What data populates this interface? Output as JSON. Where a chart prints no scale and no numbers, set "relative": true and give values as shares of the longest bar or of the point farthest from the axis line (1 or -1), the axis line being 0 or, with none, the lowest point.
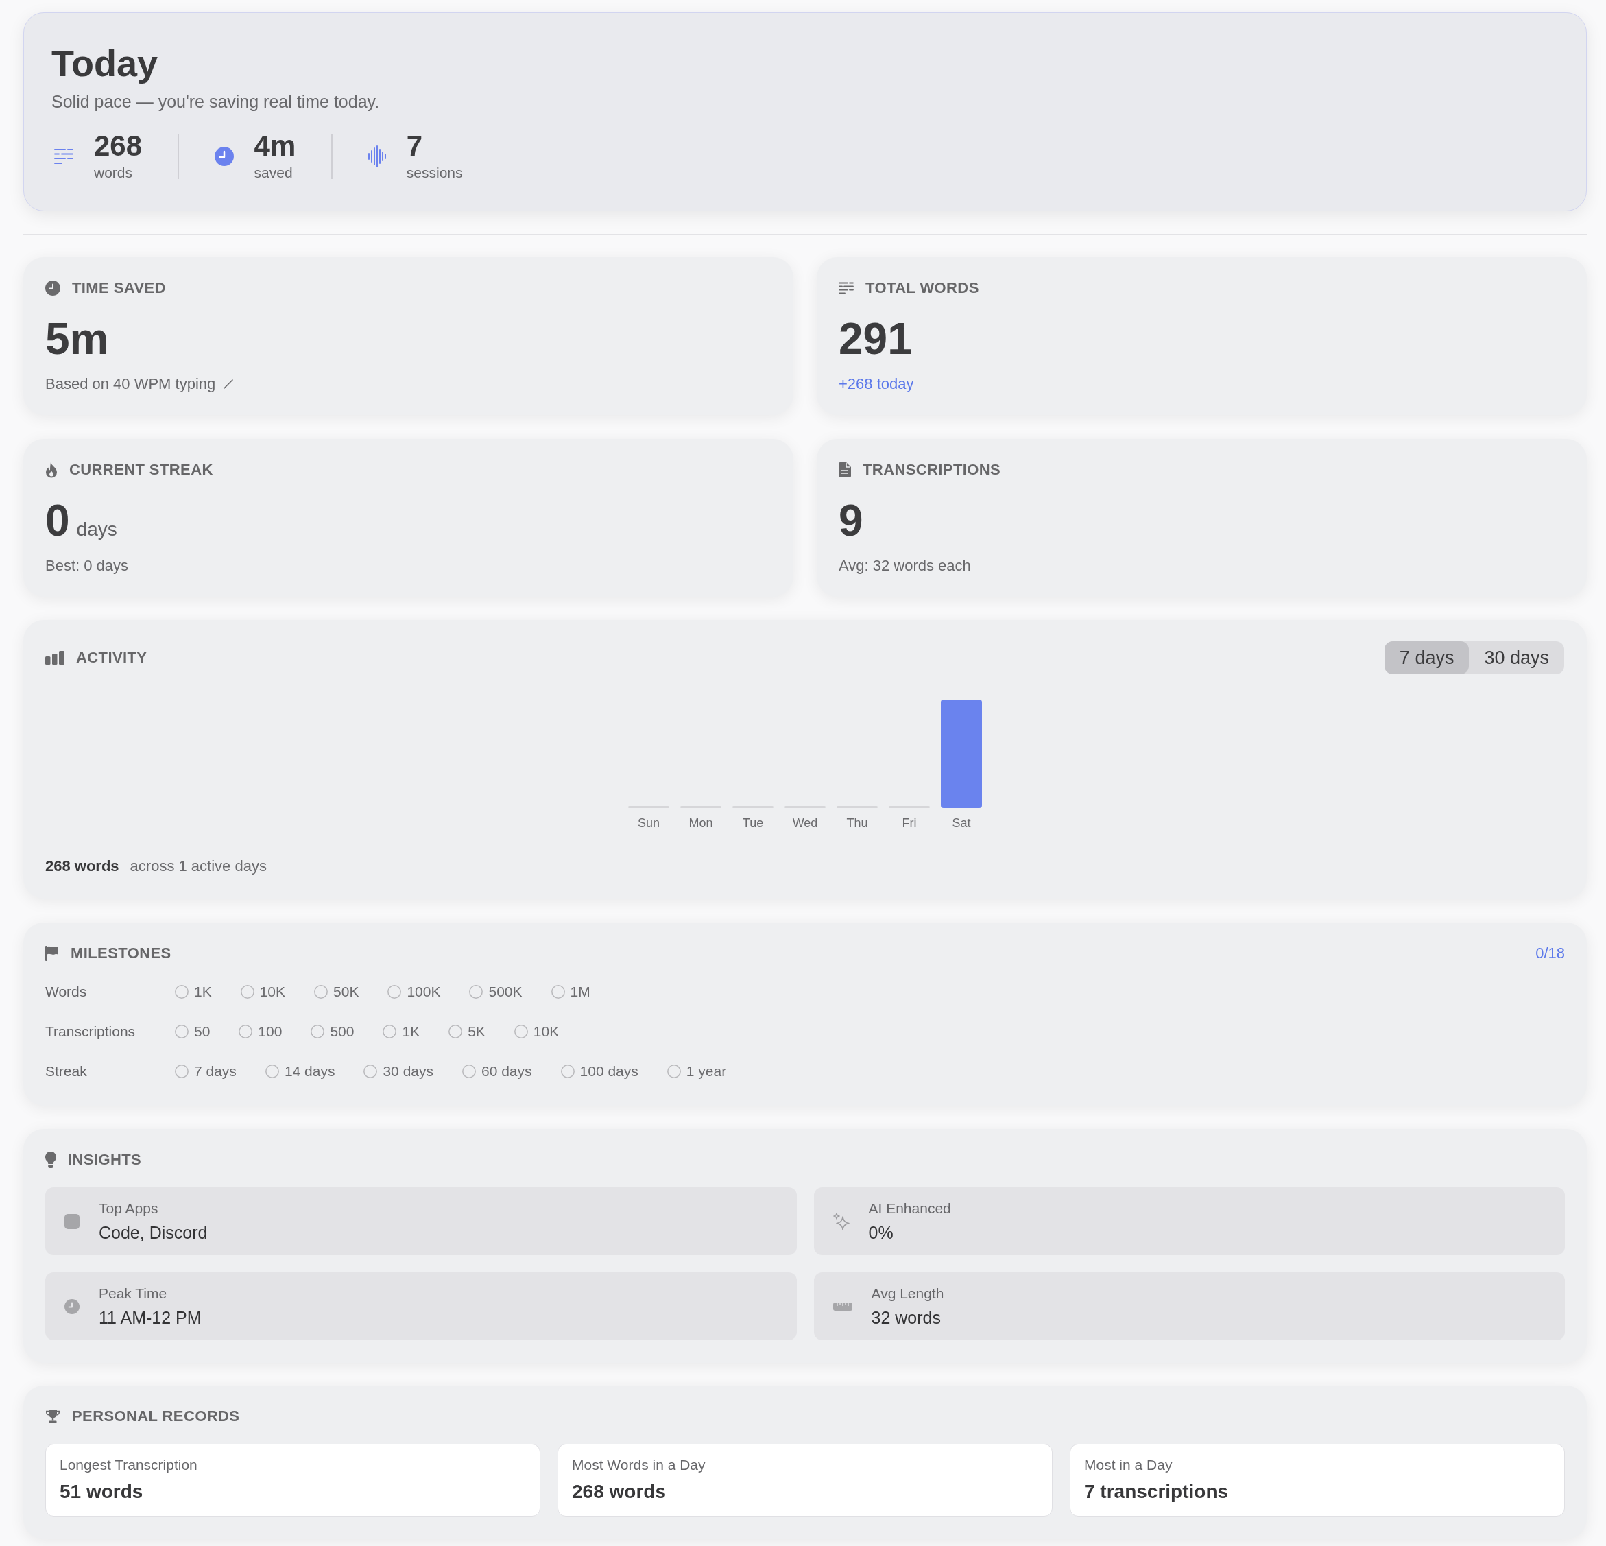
{
  "today": {
    "title": "Today",
    "subtitle": "Solid pace — you're saving real time today.",
    "stats": [
      {
        "kind": "words",
        "value": "268",
        "label": "words"
      },
      {
        "kind": "time",
        "value": "4m",
        "label": "saved"
      },
      {
        "kind": "sessions",
        "value": "7",
        "label": "sessions"
      }
    ]
  },
  "stat_cards": [
    {
      "kind": "time",
      "title": "TIME SAVED",
      "value": "5m",
      "note": "Based on 40 WPM typing",
      "editable": true
    },
    {
      "kind": "words",
      "title": "TOTAL WORDS",
      "value": "291",
      "trend": "+268 today",
      "editable": false
    },
    {
      "kind": "streak",
      "title": "CURRENT STREAK",
      "value": "0",
      "unit": "days",
      "note": "Best: 0 days",
      "editable": false
    },
    {
      "kind": "transcriptions",
      "title": "TRANSCRIPTIONS",
      "value": "9",
      "note": "Avg: 32 words each",
      "editable": false
    }
  ],
  "activity": {
    "title": "ACTIVITY",
    "ranges": [
      {
        "label": "7 days",
        "selected": true
      },
      {
        "label": "30 days",
        "selected": false
      }
    ],
    "chart_data": {
      "type": "bar",
      "relative": true,
      "categories": [
        "Sun",
        "Mon",
        "Tue",
        "Wed",
        "Thu",
        "Fri",
        "Sat"
      ],
      "values": [
        0,
        0,
        0,
        0,
        0,
        0,
        1
      ]
    },
    "summary": {
      "total": "268 words",
      "detail": "across 1 active days"
    }
  },
  "milestones": {
    "title": "MILESTONES",
    "progress": "0/18",
    "groups": [
      {
        "label": "Words",
        "items": [
          {
            "label": "1K",
            "achieved": false
          },
          {
            "label": "10K",
            "achieved": false
          },
          {
            "label": "50K",
            "achieved": false
          },
          {
            "label": "100K",
            "achieved": false
          },
          {
            "label": "500K",
            "achieved": false
          },
          {
            "label": "1M",
            "achieved": false
          }
        ]
      },
      {
        "label": "Transcriptions",
        "items": [
          {
            "label": "50",
            "achieved": false
          },
          {
            "label": "100",
            "achieved": false
          },
          {
            "label": "500",
            "achieved": false
          },
          {
            "label": "1K",
            "achieved": false
          },
          {
            "label": "5K",
            "achieved": false
          },
          {
            "label": "10K",
            "achieved": false
          }
        ]
      },
      {
        "label": "Streak",
        "items": [
          {
            "label": "7 days",
            "achieved": false
          },
          {
            "label": "14 days",
            "achieved": false
          },
          {
            "label": "30 days",
            "achieved": false
          },
          {
            "label": "60 days",
            "achieved": false
          },
          {
            "label": "100 days",
            "achieved": false
          },
          {
            "label": "1 year",
            "achieved": false
          }
        ]
      }
    ]
  },
  "insights": {
    "title": "INSIGHTS",
    "items": [
      {
        "kind": "apps",
        "label": "Top Apps",
        "value": "Code, Discord"
      },
      {
        "kind": "ai",
        "label": "AI Enhanced",
        "value": "0%"
      },
      {
        "kind": "peak",
        "label": "Peak Time",
        "value": "11 AM-12 PM"
      },
      {
        "kind": "length",
        "label": "Avg Length",
        "value": "32 words"
      }
    ]
  },
  "records": {
    "title": "PERSONAL RECORDS",
    "items": [
      {
        "label": "Longest Transcription",
        "value": "51 words"
      },
      {
        "label": "Most Words in a Day",
        "value": "268 words"
      },
      {
        "label": "Most in a Day",
        "value": "7 transcriptions"
      }
    ]
  }
}
